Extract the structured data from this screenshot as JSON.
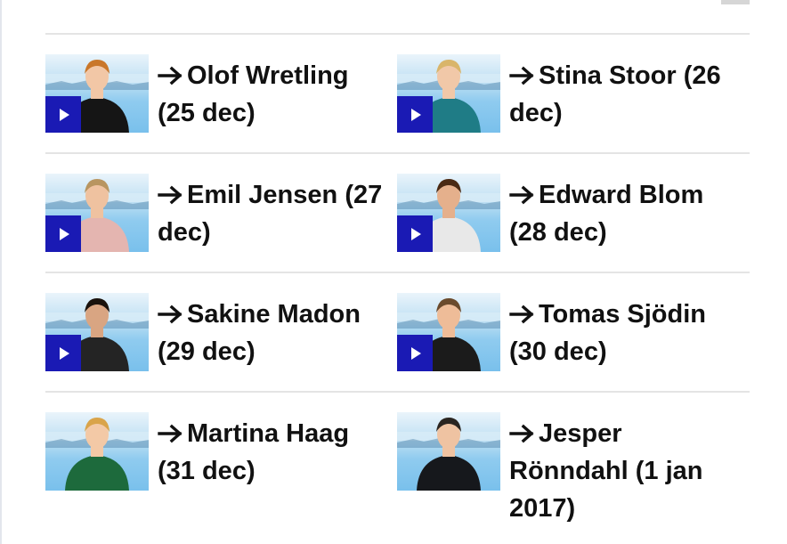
{
  "entries": [
    {
      "name": "Olof Wretling",
      "date": "(25 dec)",
      "has_play": true
    },
    {
      "name": "Stina Stoor (26",
      "date": "dec)",
      "has_play": true
    },
    {
      "name": "Emil Jensen",
      "date": "(27 dec)",
      "has_play": true
    },
    {
      "name": "Edward Blom",
      "date": "(28 dec)",
      "has_play": true
    },
    {
      "name": "Sakine Madon",
      "date": "(29 dec)",
      "has_play": true
    },
    {
      "name": "Tomas Sjödin",
      "date": "(30 dec)",
      "has_play": true
    },
    {
      "name": "Martina Haag",
      "date": "(31 dec)",
      "has_play": false
    },
    {
      "name": "Jesper",
      "date": "Rönndahl (1 jan 2017)",
      "has_play": false
    }
  ],
  "colors": {
    "play_button": "#1a1ab4",
    "text": "#111111",
    "divider": "#e4e4e4",
    "thumbnail_sky": "#8fcbef"
  },
  "icons": {
    "arrow": "arrow-right-icon",
    "play": "play-icon"
  }
}
